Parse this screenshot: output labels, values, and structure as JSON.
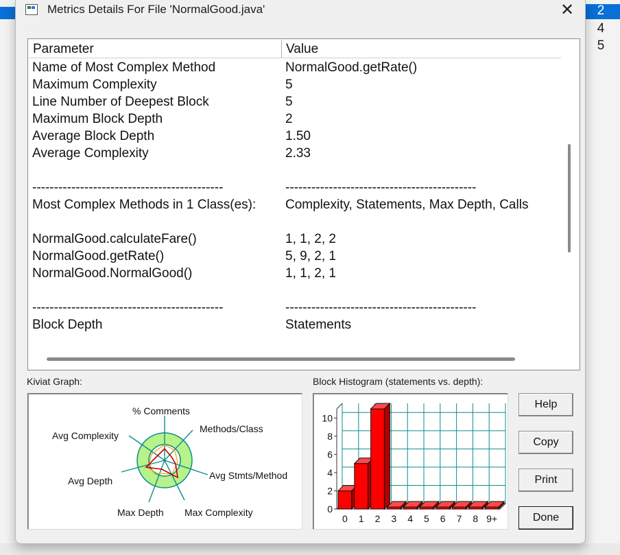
{
  "background_list": {
    "items": [
      "2",
      "4",
      "5"
    ],
    "selected_index": 0
  },
  "dialog": {
    "title": "Metrics Details For File 'NormalGood.java'",
    "close_label": "✕"
  },
  "table": {
    "headers": [
      "Parameter",
      "Value"
    ],
    "rows": [
      [
        "Name of Most Complex Method",
        "NormalGood.getRate()"
      ],
      [
        "Maximum Complexity",
        "5"
      ],
      [
        "Line Number of Deepest Block",
        "5"
      ],
      [
        "Maximum Block Depth",
        "2"
      ],
      [
        "Average Block Depth",
        "1.50"
      ],
      [
        "Average Complexity",
        "2.33"
      ],
      [
        "",
        ""
      ],
      [
        "--------------------------------------------",
        "--------------------------------------------"
      ],
      [
        "Most Complex Methods in 1 Class(es):",
        "Complexity, Statements, Max Depth, Calls"
      ],
      [
        "",
        ""
      ],
      [
        "NormalGood.calculateFare()",
        "1, 1, 2, 2"
      ],
      [
        "NormalGood.getRate()",
        "5, 9, 2, 1"
      ],
      [
        "NormalGood.NormalGood()",
        "1, 1, 2, 1"
      ],
      [
        "",
        ""
      ],
      [
        "--------------------------------------------",
        "--------------------------------------------"
      ],
      [
        "Block Depth",
        "Statements"
      ]
    ]
  },
  "kiviat": {
    "label": "Kiviat Graph:",
    "axes": [
      "% Comments",
      "Methods/Class",
      "Avg Stmts/Method",
      "Max Complexity",
      "Max Depth",
      "Avg Depth",
      "Avg Complexity"
    ],
    "colors": {
      "ring": "#b7f28a",
      "axis": "#0c8c8c",
      "line": "#c00000"
    }
  },
  "histogram": {
    "label": "Block Histogram (statements vs. depth):",
    "chart_data": {
      "type": "bar",
      "categories": [
        "0",
        "1",
        "2",
        "3",
        "4",
        "5",
        "6",
        "7",
        "8",
        "9+"
      ],
      "values": [
        2,
        5,
        11,
        0,
        0,
        0,
        0,
        0,
        0,
        0
      ],
      "ylim": [
        0,
        11
      ],
      "yticks": [
        "0",
        "2",
        "4",
        "6",
        "8",
        "10"
      ],
      "grid": true,
      "bar_color": "#ff0000",
      "grid_color": "#0c8c8c"
    }
  },
  "buttons": {
    "help": "Help",
    "copy": "Copy",
    "print": "Print",
    "done": "Done"
  }
}
